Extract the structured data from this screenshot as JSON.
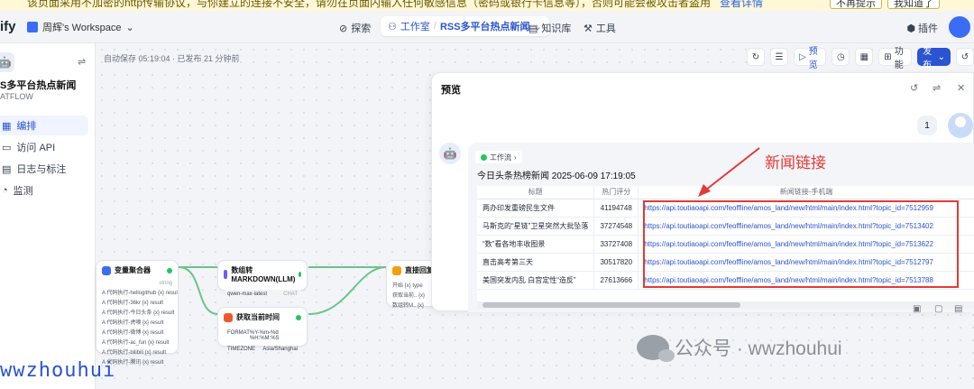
{
  "banner": {
    "text": "该页面采用不加密的http传输协议，与你建立的连接不安全，请勿在页面内输入任何敏感信息（密码或银行卡信息等），否则可能会被攻击者盗用",
    "link": "查看详情",
    "btn_no_prompt": "不再提示",
    "btn_got_it": "我知道了"
  },
  "nav": {
    "logo": "ify",
    "workspace": "周辉's Workspace",
    "explore": "探索",
    "studio": "工作室",
    "app_pill": "RSS多平台热点新闻",
    "knowledge": "知识库",
    "tools": "工具",
    "plugins": "插件"
  },
  "sidebar": {
    "app_title": "S多平台热点新闻",
    "app_type": "ATFLOW",
    "items": [
      {
        "label": "编排"
      },
      {
        "label": "访问 API"
      },
      {
        "label": "日志与标注"
      },
      {
        "label": "监测"
      }
    ]
  },
  "canvas": {
    "autosave": "自动保存 05:19:04 · 已发布 21 分钟前",
    "toolbar": {
      "preview": "预览",
      "features": "功能",
      "publish": "发布"
    },
    "nodes": {
      "aggregator": {
        "title": "变量聚合器",
        "rows": [
          "A 代码执行-hellogithub {x} result",
          "A 代码执行-36kr {x} result",
          "A 代码执行-今日头条 {x} result",
          "A 代码执行-虎嗅 {x} result",
          "A 代码执行-微博 {x} result",
          "A 代码执行-ac_fun {x} result",
          "A 代码执行-bilibili {x} result",
          "A 代码执行-腾讯 {x} result"
        ],
        "tag": "string"
      },
      "llm": {
        "title": "数组转MARKDOWN(LLM)",
        "model": "qwen-max-latest",
        "model_tag": "CHAT"
      },
      "time": {
        "title": "获取当前时间",
        "format_label": "FORMAT",
        "format_value": "%Y-%m-%d %H:%M:%S",
        "tz_label": "TIMEZONE",
        "tz_value": "Asia/Shanghai"
      },
      "reply": {
        "title": "直接回复",
        "rows": [
          "开始 {x} type",
          "获取当前.. {x}",
          "数组转M.. {x}"
        ]
      }
    }
  },
  "preview": {
    "title": "预览",
    "user_message": "1",
    "workflow_tag": "工作流",
    "answer_title": "今日头条热榜新闻 2025-06-09 17:19:05",
    "table": {
      "headers": [
        "标题",
        "热门评分",
        "新闻链接-手机端"
      ],
      "rows": [
        [
          "两办印发重磅民生文件",
          "41194748",
          "https://api.toutiaoapi.com/feoffline/amos_land/new/html/main/index.html?topic_id=7512959"
        ],
        [
          "马斯克的“星链”卫星突然大批坠落",
          "37274548",
          "https://api.toutiaoapi.com/feoffline/amos_land/new/html/main/index.html?topic_id=7513402"
        ],
        [
          "“数”看各地丰收图景",
          "33727408",
          "https://api.toutiaoapi.com/feoffline/amos_land/new/html/main/index.html?topic_id=7513622"
        ],
        [
          "直击高考第三天",
          "30517820",
          "https://api.toutiaoapi.com/feoffline/amos_land/new/html/main/index.html?topic_id=7512797"
        ],
        [
          "美国突发内乱 白宫定性“造反”",
          "27613666",
          "https://api.toutiaoapi.com/feoffline/amos_land/new/html/main/index.html?topic_id=7513788"
        ]
      ]
    },
    "annotation": "新闻链接"
  },
  "watermarks": {
    "left": "wwzhouhui",
    "wechat": "公众号 · wwzhouhui"
  },
  "colors": {
    "accent": "#2a54d1",
    "annotation_red": "#e53935",
    "success": "#22c55e"
  }
}
